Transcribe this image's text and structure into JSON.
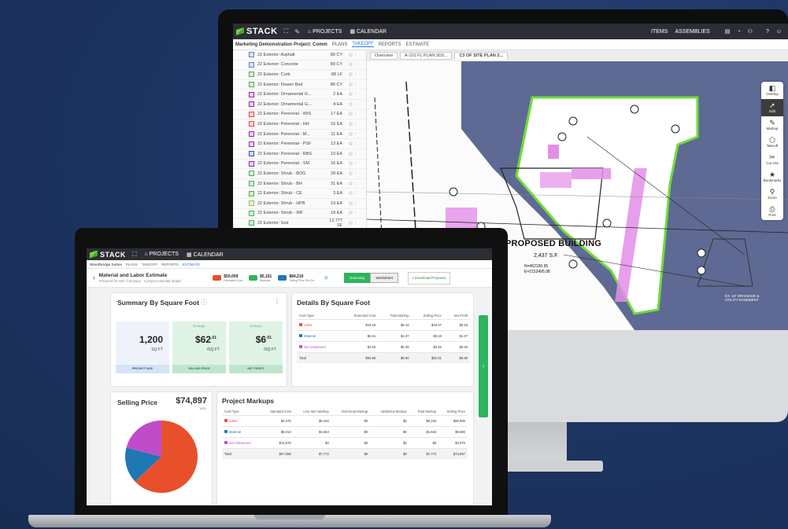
{
  "colors": {
    "background": "#1d3461",
    "green": "#2db55d",
    "labor": "#e8502b",
    "material": "#1f77b4",
    "nonmeasured": "#c14cc9"
  },
  "monitor": {
    "app_name": "STACK",
    "nav": {
      "projects": "PROJECTS",
      "calendar": "CALENDAR",
      "items": "ITEMS",
      "assemblies": "ASSEMBLIES"
    },
    "project_title": "Marketing Demonstration Project: Comm",
    "tabs": [
      "PLANS",
      "TAKEOFF",
      "REPORTS",
      "ESTIMATE"
    ],
    "active_tab": "TAKEOFF",
    "pdf_tabs": [
      "Overview",
      "A-101 FL PLAN 3D3...",
      "C3 OF SITE PLAN 2..."
    ],
    "materials": [
      {
        "name": "22 Exterior: Asphalt",
        "qty": "89 CY",
        "color": "#6b7fc1"
      },
      {
        "name": "22 Exterior: Concrete",
        "qty": "89 CY",
        "color": "#6b7fc1"
      },
      {
        "name": "22 Exterior: Curb",
        "qty": "88 LF",
        "color": "#4caf50"
      },
      {
        "name": "22 Exterior: Flower Bed",
        "qty": "88 CY",
        "color": "#4caf50"
      },
      {
        "name": "22 Exterior: Ornamental G...",
        "qty": "2 EA",
        "color": "#9c27b0"
      },
      {
        "name": "22 Exterior: Ornamental G...",
        "qty": "4 EA",
        "color": "#9c27b0"
      },
      {
        "name": "22 Exterior: Perennial - WIS",
        "qty": "17 EA",
        "color": "#f44336"
      },
      {
        "name": "22 Exterior: Perennial - HH",
        "qty": "16 EA",
        "color": "#f44336"
      },
      {
        "name": "22 Exterior: Perennial - M...",
        "qty": "11 EA",
        "color": "#9c27b0"
      },
      {
        "name": "22 Exterior: Perennial - PSF",
        "qty": "13 EA",
        "color": "#9c27b0"
      },
      {
        "name": "22 Exterior: Perennial - RBS",
        "qty": "10 EA",
        "color": "#3f51b5"
      },
      {
        "name": "22 Exterior: Perennial - SM",
        "qty": "16 EA",
        "color": "#9c27b0"
      },
      {
        "name": "22 Exterior: Shrub - BOG",
        "qty": "28 EA",
        "color": "#4caf50"
      },
      {
        "name": "22 Exterior: Shrub - BH",
        "qty": "31 EA",
        "color": "#4caf50"
      },
      {
        "name": "22 Exterior: Shrub - CE",
        "qty": "3 EA",
        "color": "#4caf50"
      },
      {
        "name": "22 Exterior: Shrub - HPB",
        "qty": "19 EA",
        "color": "#8bc34a"
      },
      {
        "name": "22 Exterior: Shrub - INF",
        "qty": "18 EA",
        "color": "#4caf50"
      },
      {
        "name": "22 Exterior: Sod",
        "qty": "12,777 SF",
        "color": "#4caf50"
      }
    ],
    "plan_label": "PROPOSED BUILDING",
    "plan_area": "2,437 S.F.",
    "plan_coords": [
      "N=462156.95",
      "E=2152495.98"
    ],
    "plan_note": "EX. 10' DRAINAGE & UTILITY EASEMENT",
    "tools": [
      "Overlay",
      "Edit",
      "Markup",
      "Takeoff",
      "Cut Out",
      "Bookmarks",
      "Zoom",
      "Print"
    ]
  },
  "laptop": {
    "app_name": "STACK",
    "nav": {
      "projects": "PROJECTS",
      "calendar": "CALENDAR"
    },
    "sub_tabs": [
      "Woodbridge Suites",
      "PLANS",
      "TAKEOFF",
      "REPORTS",
      "ESTIMATE"
    ],
    "page_title": "Material and Labor Estimate",
    "page_subtitle": "Prepared for ABC Company  ·  4 project estimate details",
    "stats": [
      {
        "value": "$50,009",
        "label": "Estimated Cost",
        "color": "#e8502b"
      },
      {
        "value": "$5,151",
        "label": "Markups",
        "color": "#2db55d"
      },
      {
        "value": "$84,210",
        "label": "Selling Price Per Ext",
        "color": "#1f77b4"
      }
    ],
    "toggle": [
      "Summary",
      "Worksheet"
    ],
    "download_label": "Download Proposal",
    "summary_title": "Summary By Square Foot",
    "summary_boxes": [
      {
        "value": "1,200",
        "unit": "SQ FT",
        "caption": "PROJECT SIZE",
        "top": ""
      },
      {
        "value": "$62",
        "sup": ".01",
        "unit": "/SQ FT",
        "caption": "SELLING PRICE",
        "top": "$ Margin"
      },
      {
        "value": "$6",
        "sup": ".01",
        "unit": "/SQ FT",
        "caption": "NET PROFIT",
        "top": "$ Margin"
      }
    ],
    "details_title": "Details By Square Foot",
    "details_headers": [
      "Cost Type",
      "Extended Cost",
      "Total Markup",
      "Selling Price",
      "Net Profit"
    ],
    "details_rows": [
      {
        "type": "Labor",
        "cells": [
          "$44.19",
          "$5.18",
          "$49.37",
          "$5.18"
        ],
        "color": "#e8502b"
      },
      {
        "type": "Material",
        "cells": [
          "$6.61",
          "$1.37",
          "$9.18",
          "$1.37"
        ],
        "color": "#1f77b4"
      },
      {
        "type": "Non-Measured",
        "cells": [
          "$3.00",
          "$0.35",
          "$3.35",
          "$0.46"
        ],
        "color": "#c14cc9"
      },
      {
        "type": "Total",
        "cells": [
          "$53.80",
          "$6.90",
          "$62.31",
          "$6.90"
        ],
        "color": ""
      }
    ],
    "selling_label": "Selling Price",
    "selling_value": "$74,897",
    "selling_unit": "USD",
    "pie": [
      {
        "name": "Labor",
        "value": 63,
        "color": "#e8502b"
      },
      {
        "name": "Material",
        "value": 16,
        "color": "#1f77b4"
      },
      {
        "name": "Non-Measured",
        "value": 21,
        "color": "#c14cc9"
      }
    ],
    "markups_title": "Project Markups",
    "markups_headers": [
      "Cost Type",
      "Standard Cost",
      "Line Item Markup",
      "Overhead Markup",
      "Additional Markup",
      "Total Markup",
      "Selling Price"
    ],
    "markups_rows": [
      {
        "type": "Labor",
        "cells": [
          "$4,475",
          "$6,192",
          "$0",
          "$0",
          "$6,192",
          "$60,695"
        ],
        "color": "#e8502b"
      },
      {
        "type": "Material",
        "cells": [
          "$8,013",
          "$1,553",
          "$0",
          "$0",
          "$1,553",
          "$9,580"
        ],
        "color": "#1f77b4"
      },
      {
        "type": "Non-Measured",
        "cells": [
          "$13,576",
          "$0",
          "$0",
          "$0",
          "$0",
          "$3,576"
        ],
        "color": "#c14cc9"
      },
      {
        "type": "Total",
        "cells": [
          "$67,056",
          "$7,772",
          "$0",
          "$0",
          "$7,772",
          "$74,897"
        ],
        "color": ""
      }
    ]
  }
}
